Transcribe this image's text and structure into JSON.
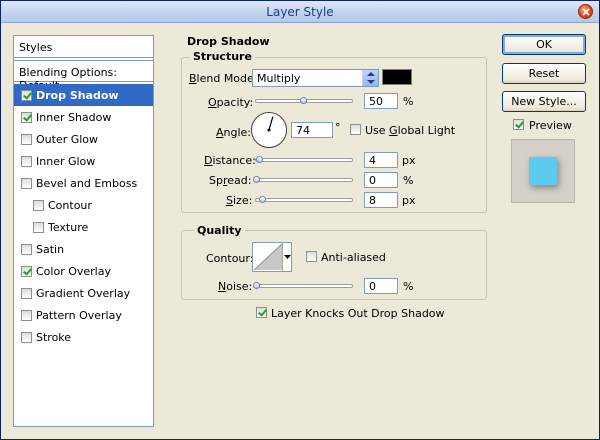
{
  "window": {
    "title": "Layer Style"
  },
  "styles_panel": {
    "header": "Styles",
    "blending_options": "Blending Options: Default",
    "items": [
      {
        "label": "Drop Shadow",
        "checked": true,
        "selected": true,
        "sub": false
      },
      {
        "label": "Inner Shadow",
        "checked": true,
        "selected": false,
        "sub": false
      },
      {
        "label": "Outer Glow",
        "checked": false,
        "selected": false,
        "sub": false
      },
      {
        "label": "Inner Glow",
        "checked": false,
        "selected": false,
        "sub": false
      },
      {
        "label": "Bevel and Emboss",
        "checked": false,
        "selected": false,
        "sub": false
      },
      {
        "label": "Contour",
        "checked": false,
        "selected": false,
        "sub": true
      },
      {
        "label": "Texture",
        "checked": false,
        "selected": false,
        "sub": true
      },
      {
        "label": "Satin",
        "checked": false,
        "selected": false,
        "sub": false
      },
      {
        "label": "Color Overlay",
        "checked": true,
        "selected": false,
        "sub": false
      },
      {
        "label": "Gradient Overlay",
        "checked": false,
        "selected": false,
        "sub": false
      },
      {
        "label": "Pattern Overlay",
        "checked": false,
        "selected": false,
        "sub": false
      },
      {
        "label": "Stroke",
        "checked": false,
        "selected": false,
        "sub": false
      }
    ]
  },
  "drop_shadow": {
    "title": "Drop Shadow",
    "structure": {
      "title": "Structure",
      "blend_mode_label": "Blend Mode:",
      "blend_mode_value": "Multiply",
      "shadow_color": "#000000",
      "opacity_label": "Opacity:",
      "opacity_value": "50",
      "opacity_unit": "%",
      "opacity_fraction": 0.5,
      "angle_label": "Angle:",
      "angle_value": "74",
      "angle_unit": "°",
      "use_global_light_label": "Use Global Light",
      "use_global_light_checked": false,
      "distance_label": "Distance:",
      "distance_value": "4",
      "distance_unit": "px",
      "spread_label": "Spread:",
      "spread_value": "0",
      "spread_unit": "%",
      "size_label": "Size:",
      "size_value": "8",
      "size_unit": "px"
    },
    "quality": {
      "title": "Quality",
      "contour_label": "Contour:",
      "anti_aliased_label": "Anti-aliased",
      "anti_aliased_checked": false,
      "noise_label": "Noise:",
      "noise_value": "0",
      "noise_unit": "%"
    },
    "knocks_out_label": "Layer Knocks Out Drop Shadow",
    "knocks_out_checked": true
  },
  "buttons": {
    "ok": "OK",
    "reset": "Reset",
    "new_style": "New Style..."
  },
  "preview": {
    "label": "Preview",
    "checked": true,
    "swatch_color": "#5ccbef"
  },
  "colors": {
    "selection": "#316ac5",
    "title_text": "#1c3d8a",
    "window_bg": "#ece9d8"
  }
}
